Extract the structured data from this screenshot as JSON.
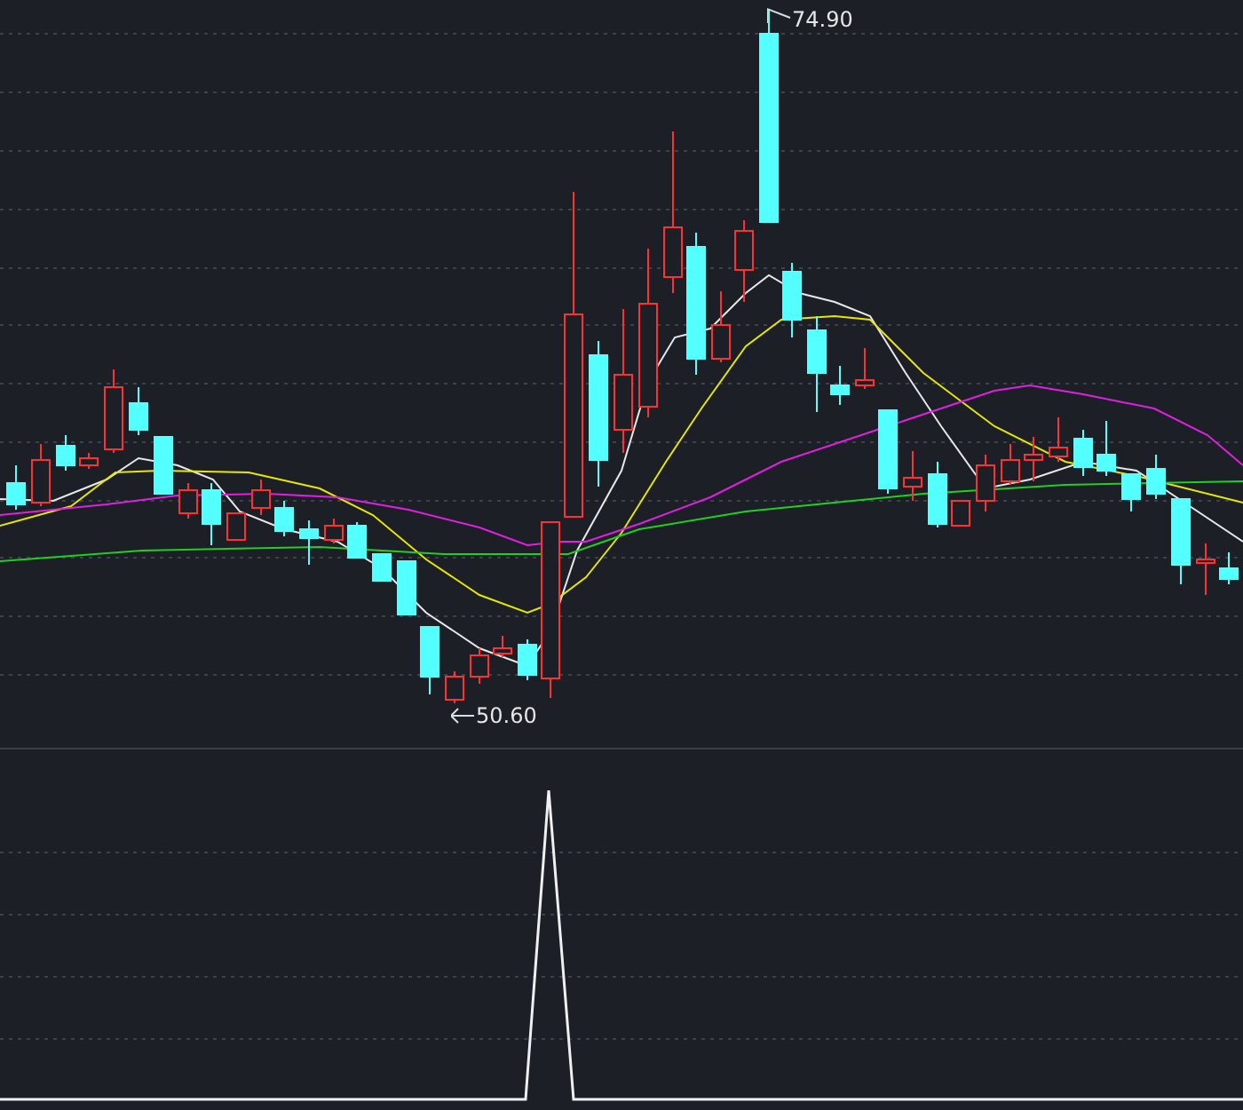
{
  "price_panel": {
    "high_label": "74.90",
    "low_label": "50.60"
  }
}
